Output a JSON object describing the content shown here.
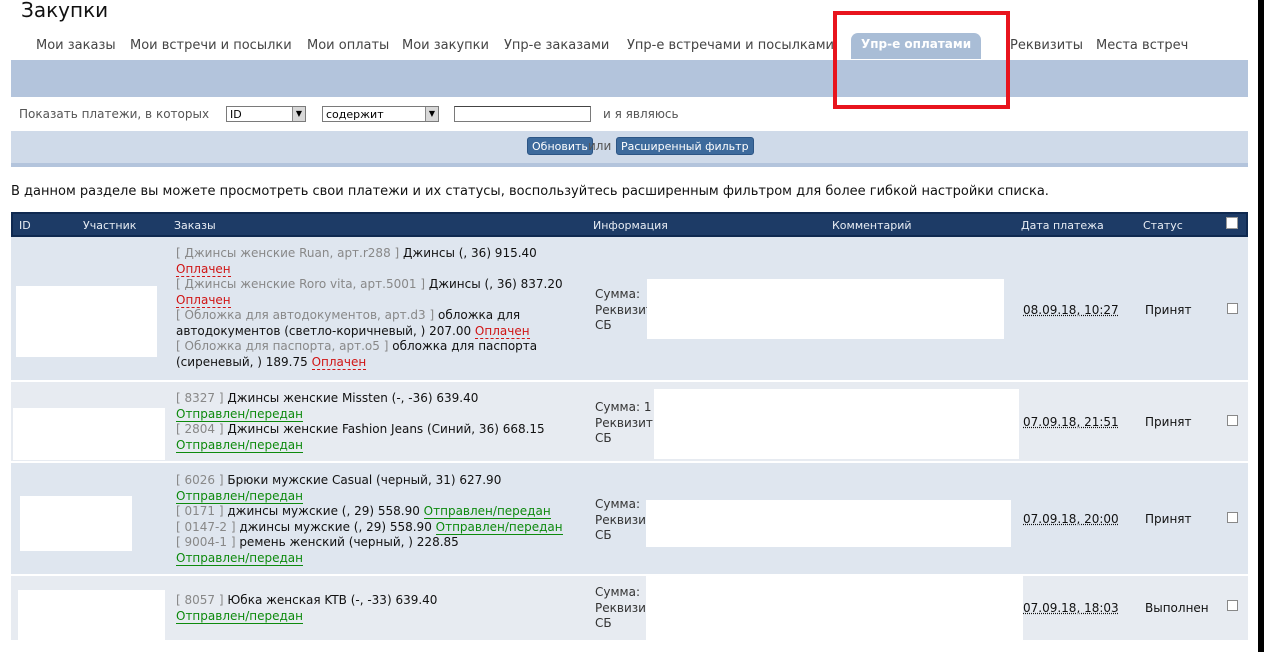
{
  "app": {
    "title": "Закупки"
  },
  "nav": {
    "items": [
      "Мои заказы",
      "Мои встречи и посылки",
      "Мои оплаты",
      "Мои закупки",
      "Упр-е заказами",
      "Упр-е встречами и посылками",
      "Упр-е оплатами",
      "Реквизиты",
      "Места встреч"
    ],
    "active_index": 6
  },
  "filter": {
    "prefix_label": "Показать платежи, в которых",
    "field_select": "ID",
    "condition_select": "содержит",
    "value_input": "",
    "suffix_label": "и я являюсь",
    "refresh_button": "Обновить",
    "or_label": "или",
    "advanced_button": "Расширенный фильтр"
  },
  "description": "В данном разделе вы можете просмотреть свои платежи и их статусы, воспользуйтесь расширенным фильтром для более гибкой настройки списка.",
  "table": {
    "headers": [
      "ID",
      "Участник",
      "Заказы",
      "Информация",
      "Комментарий",
      "Дата платежа",
      "Статус"
    ],
    "rows": [
      {
        "orders": {
          "l1_pre": "[ Джинсы женские Ruan, арт.r288 ]",
          "l1_txt": " Джинсы (, 36) 915.40",
          "l2_st": "Оплачен",
          "l3_pre": "[ Джинсы женские Roro vita, арт.5001 ]",
          "l3_txt": " Джинсы (, 36) 837.20",
          "l4_st": "Оплачен",
          "l5_pre": "[ Обложка для автодокументов, арт.d3 ]",
          "l5_txt": " обложка для",
          "l6_txt": "автодокументов (светло-коричневый, ) 207.00 ",
          "l6_st": "Оплачен",
          "l7_pre": "[ Обложка для паспорта, арт.o5 ]",
          "l7_txt": " обложка для паспорта",
          "l8_txt": "(сиреневый, ) 189.75 ",
          "l8_st": "Оплачен"
        },
        "info": {
          "sum": "Сумма:",
          "req": "Реквизит",
          "bank": "СБ"
        },
        "date": "08.09.18, 10:27",
        "status": "Принят"
      },
      {
        "orders": {
          "l1_pre": "[ 8327 ]",
          "l1_txt": " Джинсы женские Missten (-, -36) 639.40",
          "l2_st": "Отправлен/передан",
          "l3_pre": "[ 2804 ]",
          "l3_txt": " Джинсы женские Fashion Jeans (Синий, 36) 668.15",
          "l4_st": "Отправлен/передан"
        },
        "info": {
          "sum": "Сумма:",
          "sum_partial": "1",
          "req": "Реквизит",
          "bank": "СБ"
        },
        "date": "07.09.18, 21:51",
        "status": "Принят"
      },
      {
        "orders": {
          "l1_pre": "[ 6026 ]",
          "l1_txt": " Брюки мужские Casual (черный, 31) 627.90",
          "l2_st": "Отправлен/передан",
          "l3_pre": "[ 0171 ]",
          "l3_txt": " джинсы мужские (, 29) 558.90 ",
          "l3_st": "Отправлен/передан",
          "l4_pre": "[ 0147-2 ]",
          "l4_txt": " джинсы мужские (, 29) 558.90 ",
          "l4_st": "Отправлен/передан",
          "l5_pre": "[ 9004-1 ]",
          "l5_txt": " ремень женский (черный, ) 228.85",
          "l6_st": "Отправлен/передан"
        },
        "info": {
          "sum": "Сумма:",
          "req": "Реквизи",
          "bank": "СБ"
        },
        "date": "07.09.18, 20:00",
        "status": "Принят"
      },
      {
        "orders": {
          "l1_pre": "[ 8057 ]",
          "l1_txt": " Юбка женская KTB (-, -33) 639.40",
          "l2_st": "Отправлен/передан"
        },
        "info": {
          "sum": "Сумма:",
          "req": "Реквизи",
          "bank": "СБ"
        },
        "date": "07.09.18, 18:03",
        "status": "Выполнен"
      }
    ]
  },
  "colors": {
    "accent_highlight": "#e8141d",
    "header_dark": "#1d3b66",
    "band": "#b3c4dc",
    "status_paid": "#d01414",
    "status_sent": "#0d8a0d"
  }
}
